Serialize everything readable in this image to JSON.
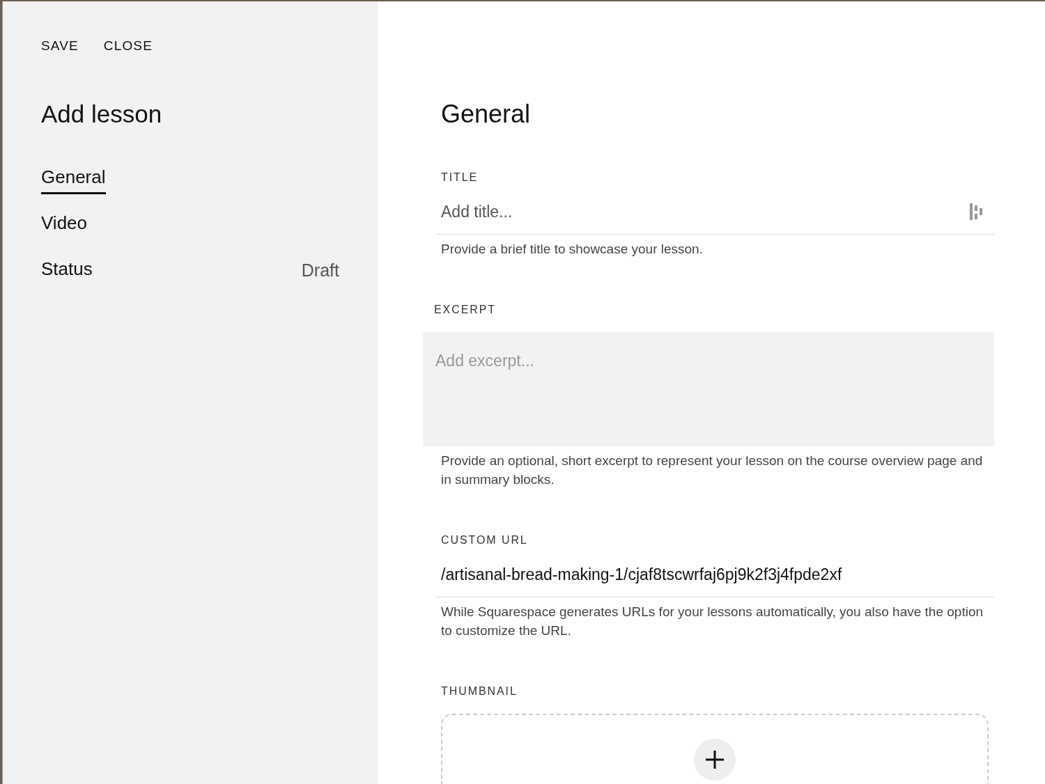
{
  "toolbar": {
    "buttons": [
      "SAVE",
      "CLOSE"
    ]
  },
  "sidebar": {
    "title": "Add lesson",
    "items": [
      {
        "label": "General",
        "selected": true
      },
      {
        "label": "Video",
        "selected": false
      },
      {
        "label": "Status",
        "value": "Draft",
        "selected": false
      }
    ]
  },
  "main": {
    "heading": "General",
    "fields": [
      {
        "kind": "text",
        "label": "TITLE",
        "placeholder": "Add title...",
        "help": "Provide a brief title to showcase your lesson."
      },
      {
        "kind": "textarea",
        "label": "EXCERPT",
        "placeholder": "Add excerpt...",
        "help": "Provide an optional, short excerpt to represent your lesson on the course overview page and in summary blocks."
      },
      {
        "kind": "text",
        "label": "CUSTOM URL",
        "value": "/artisanal-bread-making-1/cjaf8tscwrfaj6pj9k2f3j4fpde2xf",
        "help": "While Squarespace generates URLs for your lessons automatically, you also have the option to customize the URL."
      },
      {
        "kind": "upload",
        "label": "THUMBNAIL"
      }
    ]
  }
}
